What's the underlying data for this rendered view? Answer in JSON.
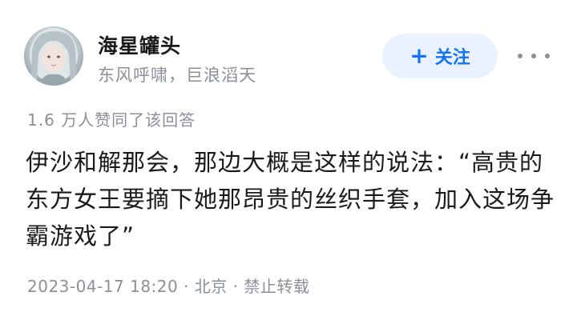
{
  "author": {
    "name": "海星罐头",
    "bio": "东风呼啸，巨浪滔天"
  },
  "actions": {
    "follow_label": "关注",
    "plus_icon": "+",
    "more_icon": "more-dots-icon"
  },
  "answer": {
    "upvote_stat": "1.6 万人赞同了该回答",
    "content": "伊沙和解那会，那边大概是这样的说法：“高贵的东方女王要摘下她那昂贵的丝织手套，加入这场争霸游戏了”",
    "meta": "2023-04-17 18:20 · 北京 · 禁止转载"
  },
  "colors": {
    "accent": "#1772f6",
    "follow_bg": "#eaf2ff",
    "muted_text": "#8a8f99",
    "body_text": "#1a1a1a"
  }
}
